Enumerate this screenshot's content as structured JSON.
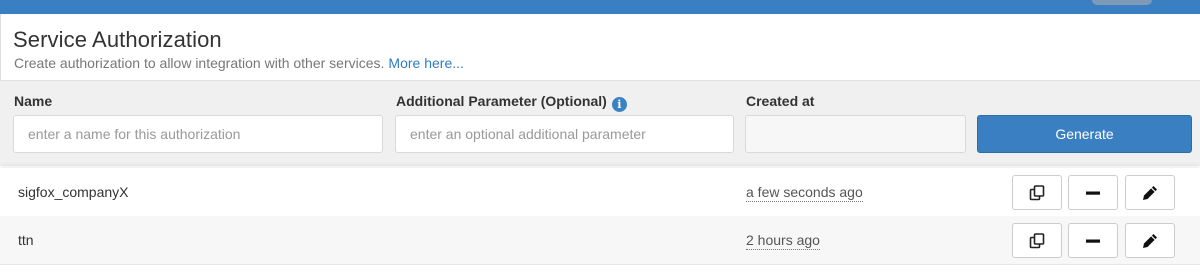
{
  "header": {
    "title": "Service Authorization",
    "subtitle": "Create authorization to allow integration with other services.",
    "more_link": "More here..."
  },
  "form": {
    "name_label": "Name",
    "name_placeholder": "enter a name for this authorization",
    "param_label": "Additional Parameter (Optional)",
    "param_placeholder": "enter an optional additional parameter",
    "created_label": "Created at",
    "generate_label": "Generate"
  },
  "rows": [
    {
      "name": "sigfox_companyX",
      "created": "a few seconds ago"
    },
    {
      "name": "ttn",
      "created": "2 hours ago"
    }
  ],
  "icons": {
    "info": "info-circle-icon",
    "copy": "copy-icon",
    "remove": "minus-icon",
    "edit": "pencil-icon"
  },
  "colors": {
    "accent": "#3a7fc1",
    "link": "#2f7bc4",
    "panel": "#f0f0f0"
  }
}
